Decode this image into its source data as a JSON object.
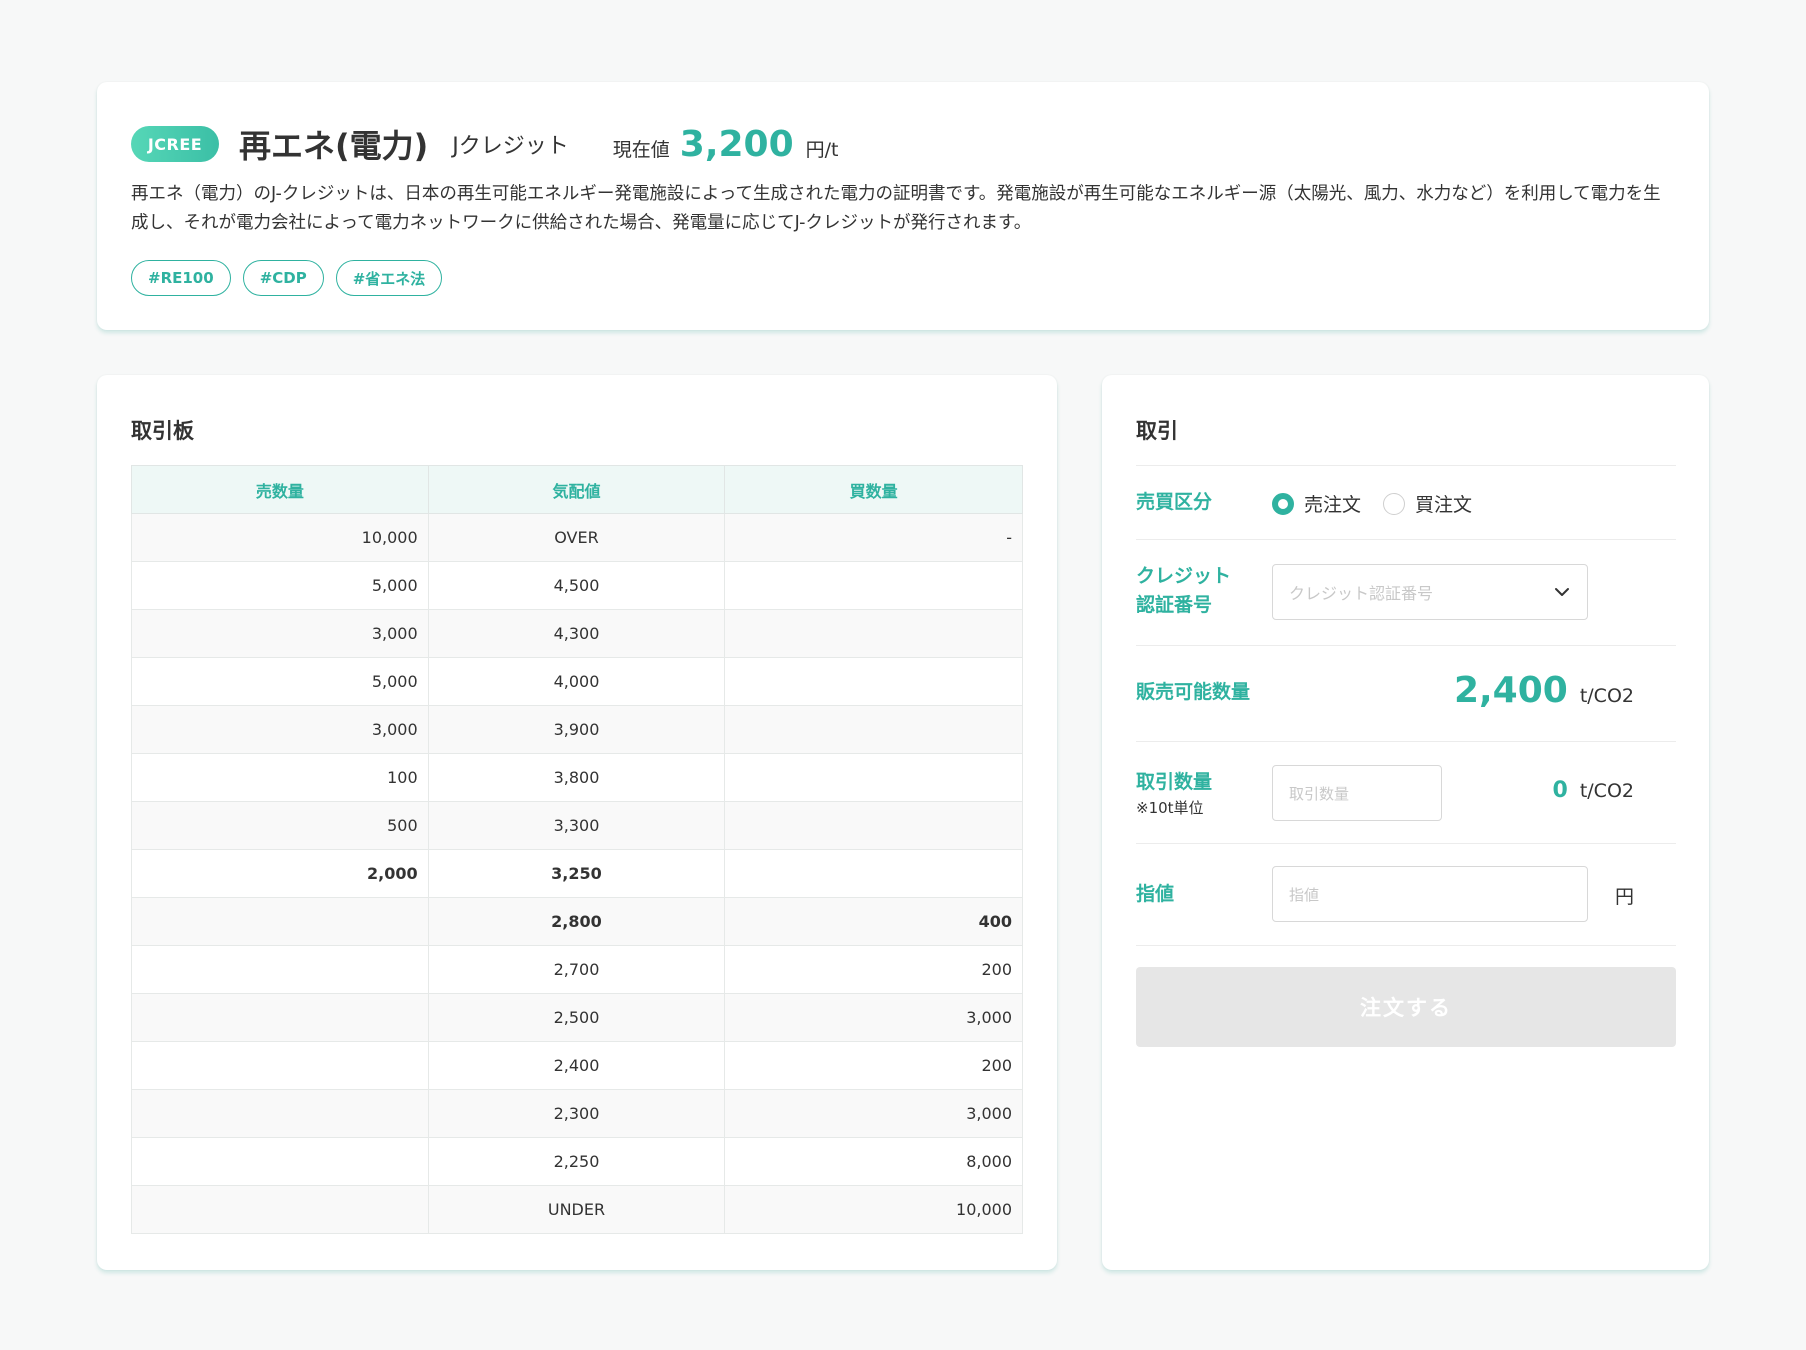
{
  "header": {
    "badge": "JCREE",
    "title": "再エネ(電力)",
    "subtitle": "Jクレジット",
    "price_label": "現在値",
    "price_value": "3,200",
    "price_unit": "円/t",
    "description": "再エネ（電力）のJ-クレジットは、日本の再生可能エネルギー発電施設によって生成された電力の証明書です。発電施設が再生可能なエネルギー源（太陽光、風力、水力など）を利用して電力を生成し、それが電力会社によって電力ネットワークに供給された場合、発電量に応じてJ-クレジットが発行されます。",
    "tags": [
      "#RE100",
      "#CDP",
      "#省エネ法"
    ]
  },
  "order_book": {
    "title": "取引板",
    "columns": [
      "売数量",
      "気配値",
      "買数量"
    ],
    "rows": [
      {
        "sell": "10,000",
        "price": "OVER",
        "buy": "-"
      },
      {
        "sell": "5,000",
        "price": "4,500",
        "buy": ""
      },
      {
        "sell": "3,000",
        "price": "4,300",
        "buy": ""
      },
      {
        "sell": "5,000",
        "price": "4,000",
        "buy": ""
      },
      {
        "sell": "3,000",
        "price": "3,900",
        "buy": ""
      },
      {
        "sell": "100",
        "price": "3,800",
        "buy": ""
      },
      {
        "sell": "500",
        "price": "3,300",
        "buy": ""
      },
      {
        "sell": "2,000",
        "price": "3,250",
        "buy": "",
        "highlight": "green"
      },
      {
        "sell": "",
        "price": "2,800",
        "buy": "400",
        "highlight": "red"
      },
      {
        "sell": "",
        "price": "2,700",
        "buy": "200"
      },
      {
        "sell": "",
        "price": "2,500",
        "buy": "3,000"
      },
      {
        "sell": "",
        "price": "2,400",
        "buy": "200"
      },
      {
        "sell": "",
        "price": "2,300",
        "buy": "3,000"
      },
      {
        "sell": "",
        "price": "2,250",
        "buy": "8,000"
      },
      {
        "sell": "",
        "price": "UNDER",
        "buy": "10,000"
      }
    ]
  },
  "trade": {
    "title": "取引",
    "side_label": "売買区分",
    "side_options": [
      "売注文",
      "買注文"
    ],
    "side_selected": "売注文",
    "credit_label_1": "クレジット",
    "credit_label_2": "認証番号",
    "credit_placeholder": "クレジット認証番号",
    "available_label": "販売可能数量",
    "available_value": "2,400",
    "available_unit": "t/CO2",
    "qty_label": "取引数量",
    "qty_note": "※10t単位",
    "qty_placeholder": "取引数量",
    "qty_value": "0",
    "qty_unit": "t/CO2",
    "limit_label": "指値",
    "limit_placeholder": "指値",
    "limit_unit": "円",
    "order_button": "注文する"
  },
  "colors": {
    "accent": "#2fb2a0",
    "sell_highlight": "#2fb2a0",
    "buy_highlight": "#e5545a",
    "disabled_button": "#e6e6e6"
  },
  "icons": {
    "select_arrow": "chevron-down-icon"
  }
}
